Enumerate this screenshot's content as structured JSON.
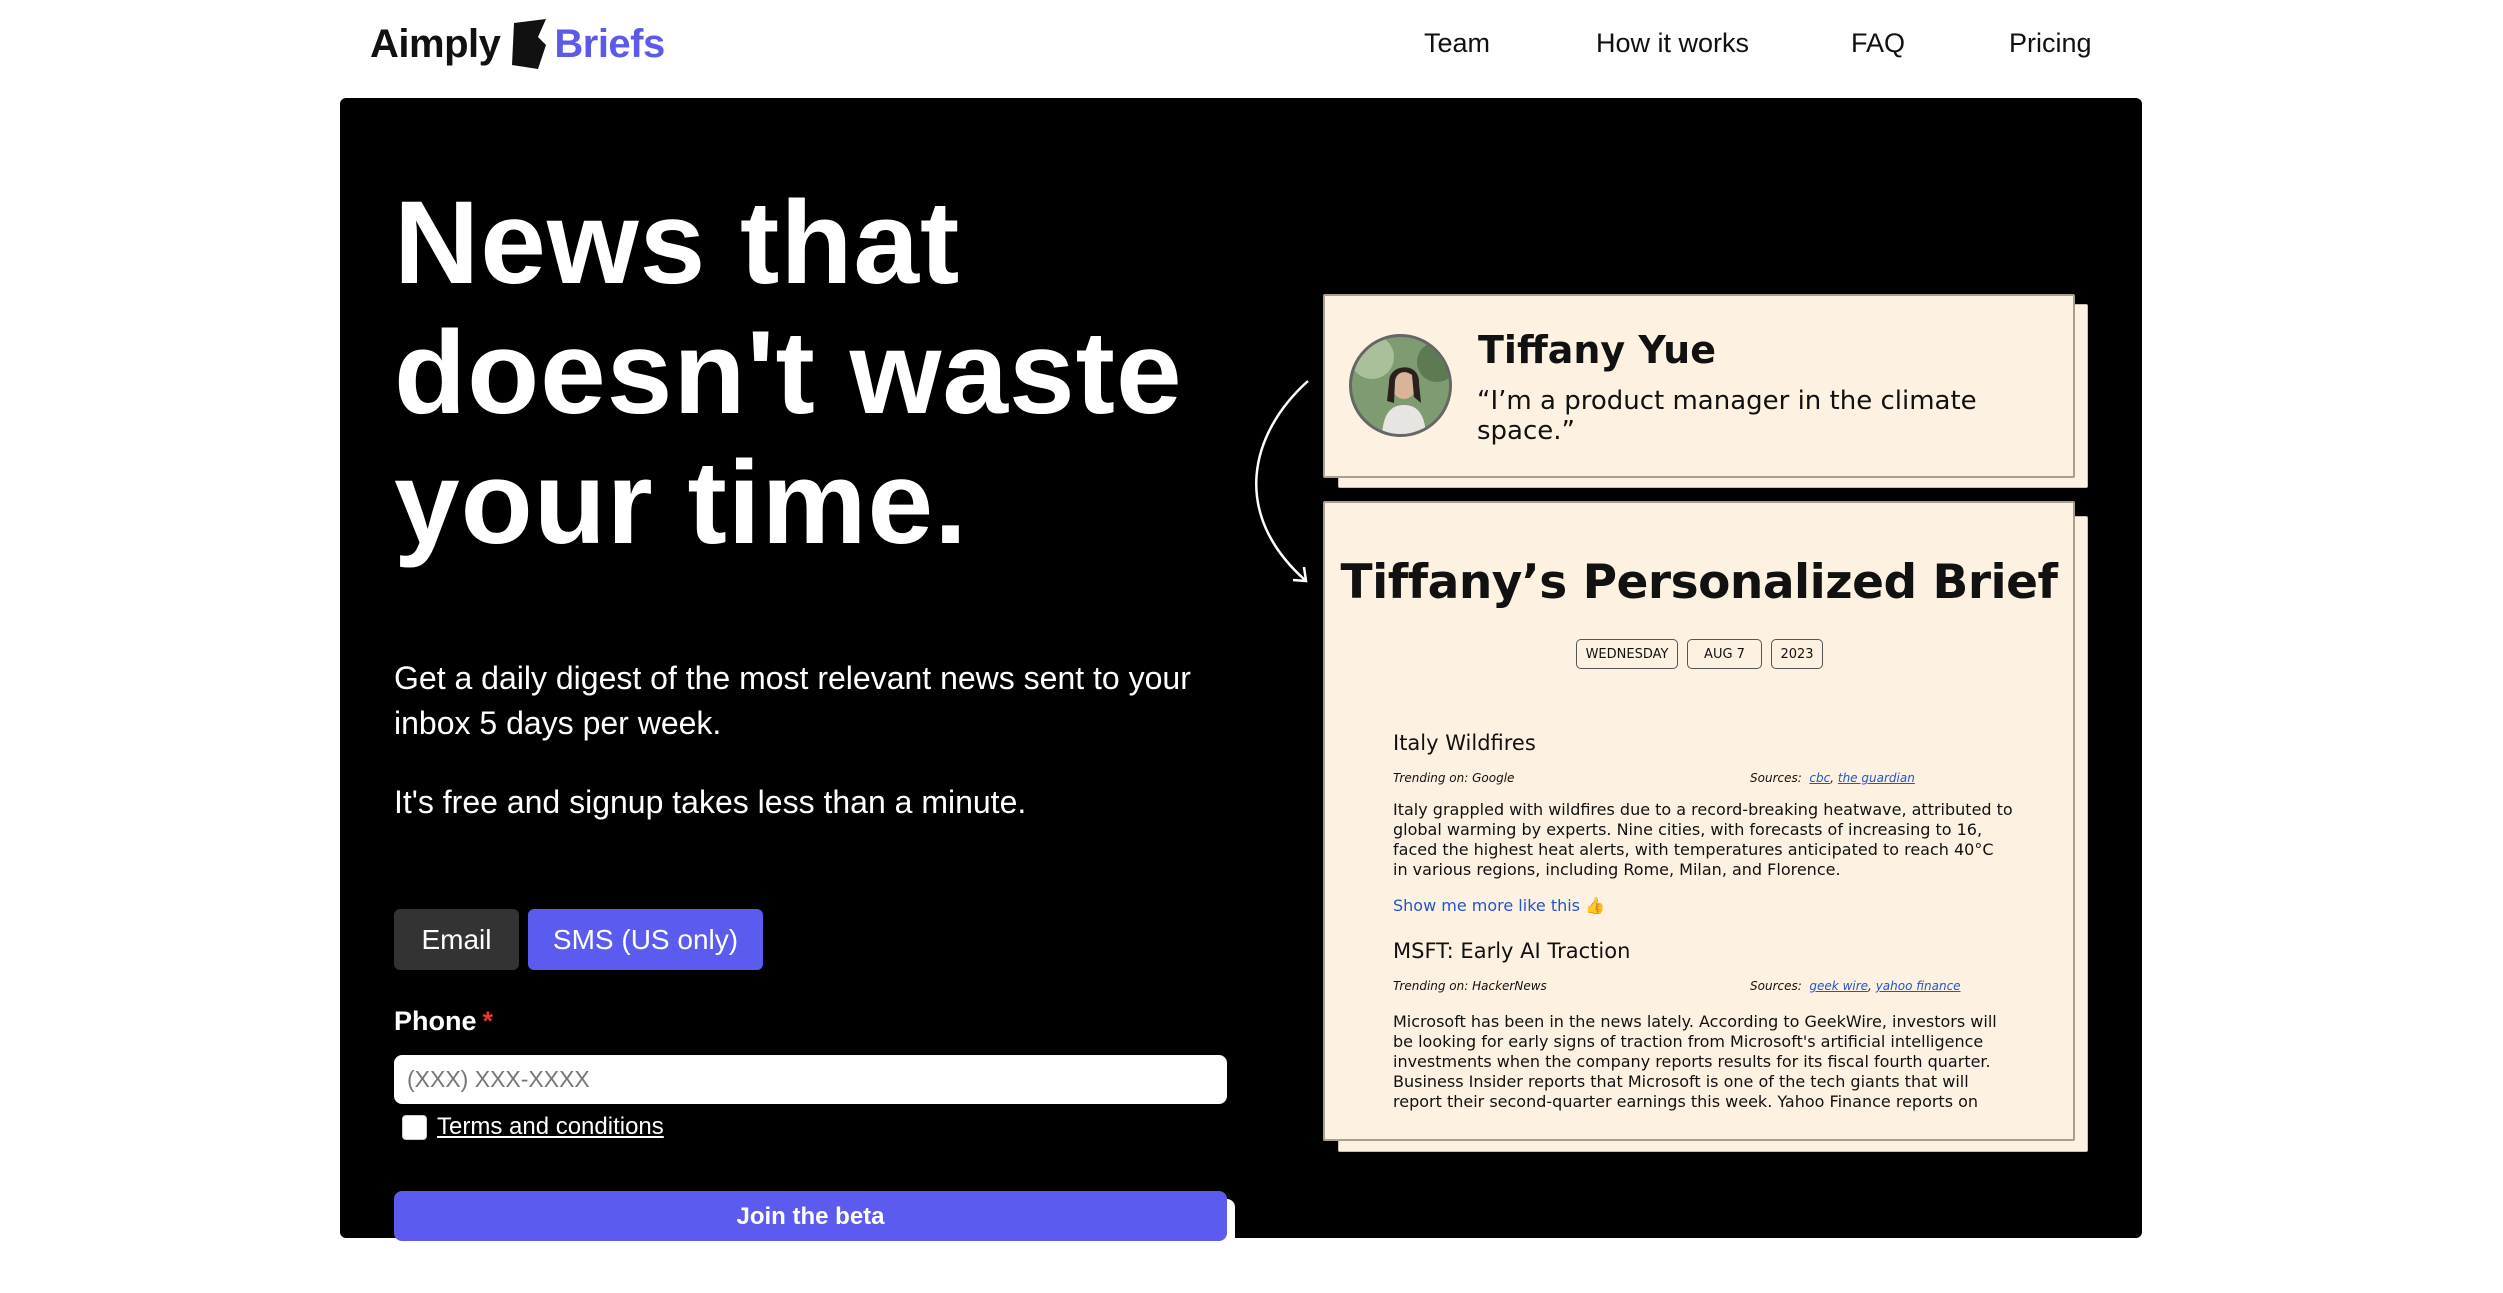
{
  "brand": {
    "name_part1": "Aimply",
    "name_part2": "Briefs",
    "accent_color": "#5b5be8"
  },
  "nav": {
    "items": [
      "Team",
      "How it works",
      "FAQ",
      "Pricing"
    ]
  },
  "hero": {
    "headline": "News that doesn't waste your time.",
    "subtitle1": "Get a daily digest of the most relevant news sent to your inbox 5 days per week.",
    "subtitle2": "It's free and signup takes less than a minute."
  },
  "form": {
    "tabs": [
      {
        "label": "Email",
        "selected": false
      },
      {
        "label": "SMS (US only)",
        "selected": true
      }
    ],
    "phone_label": "Phone",
    "required_mark": "*",
    "phone_placeholder": "(XXX) XXX-XXXX",
    "terms_label": "Terms and conditions",
    "terms_checked": false,
    "submit_label": "Join the beta"
  },
  "profile": {
    "name": "Tiffany Yue",
    "quote": "“I’m a product manager in the climate space.”"
  },
  "brief": {
    "title": "Tiffany’s Personalized Brief",
    "date": [
      "WEDNESDAY",
      "AUG 7",
      "2023"
    ],
    "stories": [
      {
        "title": "Italy Wildfires",
        "trending": "Trending on: Google",
        "sources_label": "Sources:",
        "sources": [
          "cbc",
          "the guardian"
        ],
        "body": "Italy grappled with wildfires due to a record-breaking heatwave, attributed to global warming by experts. Nine cities, with forecasts of increasing to 16, faced the highest heat alerts, with temperatures anticipated to reach 40°C in various regions, including Rome, Milan, and Florence.",
        "more_link": "Show me more like this 👍"
      },
      {
        "title": "MSFT: Early AI Traction",
        "trending": "Trending on: HackerNews",
        "sources_label": "Sources:",
        "sources": [
          "geek wire",
          "yahoo finance"
        ],
        "body": "Microsoft has been in the news lately. According to GeekWire, investors will be looking for early signs of traction from Microsoft's artificial intelligence investments when the company reports results for its fiscal fourth quarter. Business Insider reports that Microsoft is one of the tech giants that will report their second-quarter earnings this week. Yahoo Finance reports on"
      }
    ]
  },
  "carousel": {
    "count": 3,
    "active_index": 0
  }
}
